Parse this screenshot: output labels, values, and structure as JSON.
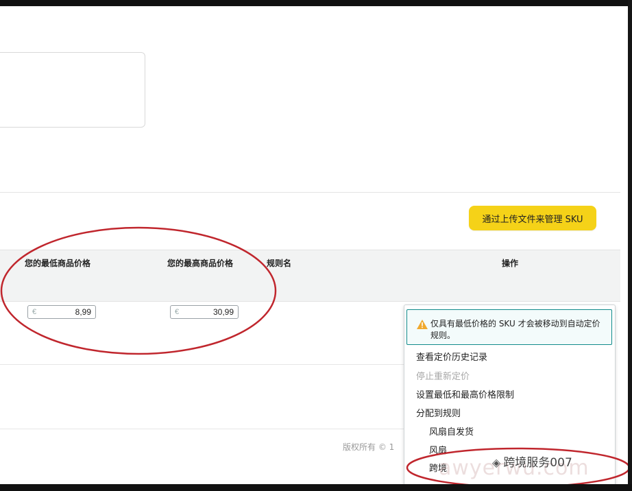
{
  "toolbar": {
    "upload_label": "通过上传文件来管理 SKU"
  },
  "table": {
    "headers": {
      "min_price": "您的最低商品价格",
      "max_price": "您的最高商品价格",
      "rule_name": "规则名",
      "actions": "操作"
    },
    "row": {
      "currency_symbol": "€",
      "min_price": "8,99",
      "max_price": "30,99"
    }
  },
  "dropdown": {
    "warning": "仅具有最低价格的 SKU 才会被移动到自动定价规则。",
    "items": [
      {
        "label": "查看定价历史记录",
        "enabled": true
      },
      {
        "label": "停止重新定价",
        "enabled": false
      },
      {
        "label": "设置最低和最高价格限制",
        "enabled": true
      },
      {
        "label": "分配到规则",
        "enabled": true
      }
    ],
    "rules": [
      "风扇自发货",
      "风扇",
      "跨境"
    ]
  },
  "footer": {
    "copyright": "版权所有 © 1"
  },
  "watermark": {
    "text": "跨境服务007",
    "ghost": "awyerwu.com"
  },
  "colors": {
    "accent_button": "#f5d218",
    "warning_border": "#0f8a8a",
    "annotation_red": "#c0262d"
  }
}
